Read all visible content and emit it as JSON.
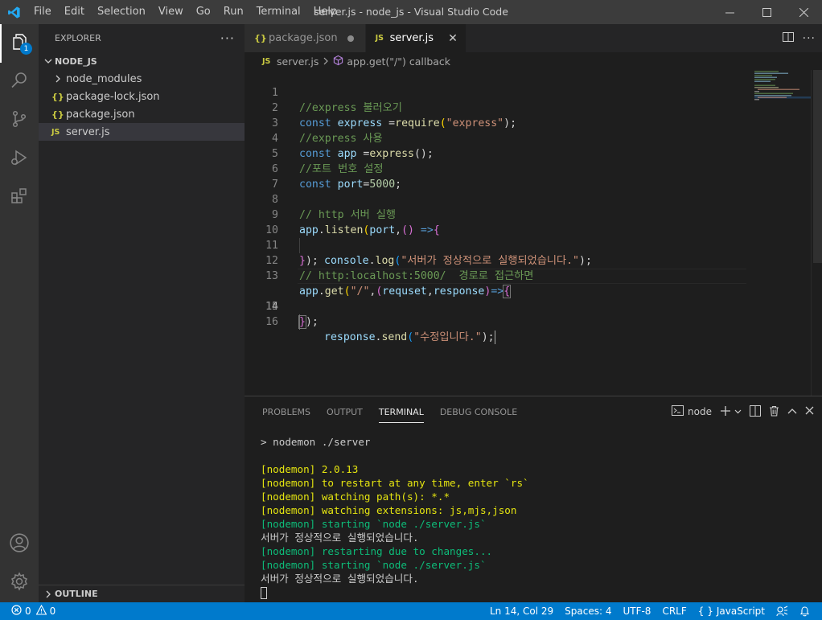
{
  "window": {
    "title": "server.js - node_js - Visual Studio Code",
    "menu": [
      "File",
      "Edit",
      "Selection",
      "View",
      "Go",
      "Run",
      "Terminal",
      "Help"
    ]
  },
  "activity": {
    "explorer_badge": "1"
  },
  "sidebar": {
    "title": "EXPLORER",
    "more": "···",
    "section": "NODE_JS",
    "items": [
      {
        "label": "node_modules",
        "type": "folder"
      },
      {
        "label": "package-lock.json",
        "type": "json"
      },
      {
        "label": "package.json",
        "type": "json"
      },
      {
        "label": "server.js",
        "type": "js"
      }
    ],
    "outline": "OUTLINE"
  },
  "tabs": [
    {
      "label": "package.json",
      "icon": "{}",
      "modified": true
    },
    {
      "label": "server.js",
      "icon": "JS",
      "active": true
    }
  ],
  "breadcrumbs": {
    "file": "server.js",
    "symbol": "app.get(\"/\") callback"
  },
  "editor": {
    "current_line": 14,
    "line_numbers": [
      "1",
      "2",
      "3",
      "4",
      "5",
      "6",
      "7",
      "8",
      "9",
      "10",
      "11",
      "12",
      "13",
      "14",
      "15",
      "16"
    ],
    "tokens": {
      "l1": "//express 불러오기",
      "l2a": "const",
      "l2b": "express",
      "l2c": " =",
      "l2d": "require",
      "l2e": "(",
      "l2f": "\"express\"",
      "l2g": ");",
      "l3": "//express 사용",
      "l4a": "const",
      "l4b": "app",
      "l4c": " =",
      "l4d": "express",
      "l4e": "();",
      "l5": "//포트 번호 설정",
      "l6a": "const",
      "l6b": "port",
      "l6c": "=",
      "l6d": "5000",
      "l6e": ";",
      "l8": "// http 서버 실행",
      "l9a": "app",
      "l9b": ".",
      "l9c": "listen",
      "l9d": "(",
      "l9e": "port",
      "l9f": ",",
      "l9g": "()",
      "l9h": " =>",
      "l9i": "{",
      "l10a": "console",
      "l10b": ".",
      "l10c": "log",
      "l10d": "(",
      "l10e": "\"서버가 정상적으로 실행되었습니다.\"",
      "l10f": ");",
      "l11a": "}",
      "l11b": ");",
      "l12": "// http:localhost:5000/  경로로 접근하면",
      "l13a": "app",
      "l13b": ".",
      "l13c": "get",
      "l13d": "(",
      "l13e": "\"/\"",
      "l13f": ",",
      "l13g": "(",
      "l13h": "requset",
      "l13i": ",",
      "l13j": "response",
      "l13k": ")",
      "l13l": "=>",
      "l13m": "{",
      "l14a": "response",
      "l14b": ".",
      "l14c": "send",
      "l14d": "(",
      "l14e": "\"수정입니다.\"",
      "l14f": ");",
      "l15a": "}",
      "l15b": ");"
    }
  },
  "panel": {
    "tabs": [
      "PROBLEMS",
      "OUTPUT",
      "TERMINAL",
      "DEBUG CONSOLE"
    ],
    "active_tab": "TERMINAL",
    "terminal_name": "node",
    "terminal_lines": [
      {
        "text": "> nodemon ./server",
        "color": "w"
      },
      {
        "text": "",
        "color": "w"
      },
      {
        "text": "[nodemon] 2.0.13",
        "color": "y"
      },
      {
        "text": "[nodemon] to restart at any time, enter `rs`",
        "color": "y"
      },
      {
        "text": "[nodemon] watching path(s): *.*",
        "color": "y"
      },
      {
        "text": "[nodemon] watching extensions: js,mjs,json",
        "color": "y"
      },
      {
        "text": "[nodemon] starting `node ./server.js`",
        "color": "g"
      },
      {
        "text": "서버가 정상적으로 실행되었습니다.",
        "color": "w"
      },
      {
        "text": "[nodemon] restarting due to changes...",
        "color": "g"
      },
      {
        "text": "[nodemon] starting `node ./server.js`",
        "color": "g"
      },
      {
        "text": "서버가 정상적으로 실행되었습니다.",
        "color": "w"
      }
    ]
  },
  "statusbar": {
    "errors": "0",
    "warnings": "0",
    "position": "Ln 14, Col 29",
    "spaces": "Spaces: 4",
    "encoding": "UTF-8",
    "eol": "CRLF",
    "language": "JavaScript"
  },
  "colors": {
    "accent": "#007acc",
    "titlebar": "#3c3c3c",
    "activity": "#333333",
    "sidebar": "#252526",
    "editor": "#1e1e1e"
  }
}
